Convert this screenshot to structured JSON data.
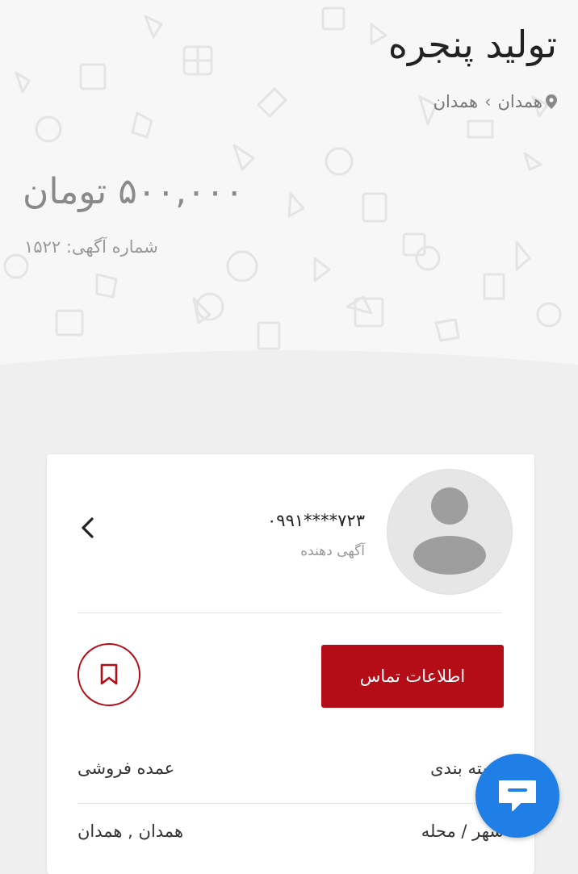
{
  "listing": {
    "title": "تولید پنجره",
    "location_city": "همدان",
    "location_area": "همدان",
    "location_separator": "›",
    "price": "۵۰۰,۰۰۰ تومان",
    "ad_number_label": "شماره آگهی:",
    "ad_number": "۱۵۲۲"
  },
  "seller": {
    "phone": "۷۲۳****۰۹۹۱",
    "role": "آگهی دهنده"
  },
  "actions": {
    "contact_label": "اطلاعات تماس"
  },
  "details": [
    {
      "label": "دسته بندی",
      "value": "عمده فروشی"
    },
    {
      "label": "شهر / محله",
      "value": "همدان , همدان"
    }
  ],
  "colors": {
    "accent": "#b40d17",
    "chat_button": "#1f7fe6",
    "page_background": "#efefef",
    "hero_background": "#f7f7f7"
  },
  "icons": {
    "location": "map-pin-icon",
    "back": "chevron-left-icon",
    "bookmark": "bookmark-icon",
    "chat": "chat-bubble-icon",
    "avatar": "user-placeholder-icon"
  }
}
